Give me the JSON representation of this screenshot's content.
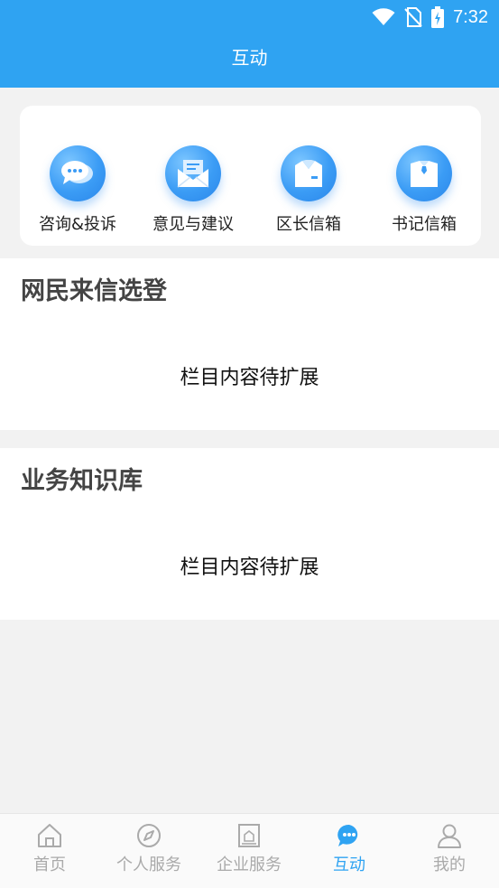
{
  "status_bar": {
    "time": "7:32"
  },
  "header": {
    "title": "互动"
  },
  "quick_actions": [
    {
      "label": "咨询&投诉",
      "icon": "chat-bubbles-icon"
    },
    {
      "label": "意见与建议",
      "icon": "mail-envelope-icon"
    },
    {
      "label": "区长信箱",
      "icon": "mailbox-suit-icon"
    },
    {
      "label": "书记信箱",
      "icon": "mailbox-tie-icon"
    }
  ],
  "sections": [
    {
      "title": "网民来信选登",
      "placeholder": "栏目内容待扩展"
    },
    {
      "title": "业务知识库",
      "placeholder": "栏目内容待扩展"
    }
  ],
  "tabbar": {
    "items": [
      {
        "label": "首页",
        "icon": "home-icon",
        "active": false
      },
      {
        "label": "个人服务",
        "icon": "compass-icon",
        "active": false
      },
      {
        "label": "企业服务",
        "icon": "building-icon",
        "active": false
      },
      {
        "label": "互动",
        "icon": "chat-icon",
        "active": true
      },
      {
        "label": "我的",
        "icon": "user-icon",
        "active": false
      }
    ]
  },
  "colors": {
    "primary": "#2fa3f2",
    "background": "#f2f2f2",
    "tab_inactive": "#aaaaaa"
  }
}
